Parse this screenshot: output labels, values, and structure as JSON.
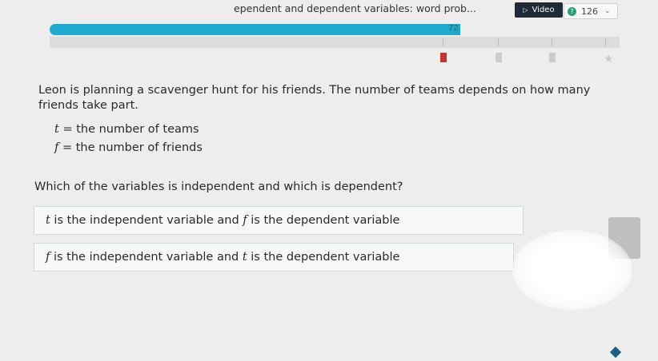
{
  "topbar": {
    "title": "ependent and dependent variables: word prob...",
    "video_label": "Video",
    "points": "126"
  },
  "progress": {
    "score": "72",
    "fraction": 0.72
  },
  "question": {
    "text": "Leon is planning a scavenger hunt for his friends. The number of teams depends on how many friends take part.",
    "variables": [
      {
        "symbol": "t",
        "eq": "=",
        "desc": "the number of teams"
      },
      {
        "symbol": "f",
        "eq": "=",
        "desc": "the number of friends"
      }
    ],
    "prompt": "Which of the variables is independent and which is dependent?"
  },
  "choices": [
    {
      "var1": "t",
      "mid": " is the independent variable and ",
      "var2": "f",
      "end": " is the dependent variable"
    },
    {
      "var1": "f",
      "mid": " is the independent variable and ",
      "var2": "t",
      "end": " is the dependent variable"
    }
  ],
  "colors": {
    "progress": "#1ea9cf",
    "current_marker": "#c8342d",
    "video_button": "#1e2a36",
    "points_icon": "#1fa378"
  }
}
